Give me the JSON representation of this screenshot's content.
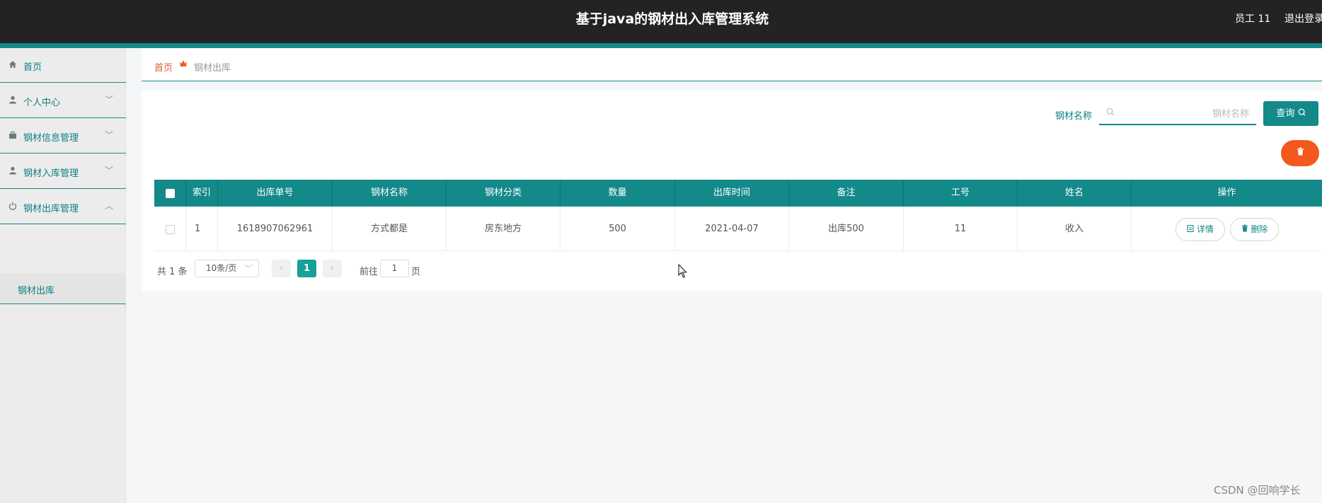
{
  "header": {
    "title": "基于java的钢材出入库管理系统",
    "user": "员工 11",
    "logout": "退出登录"
  },
  "sidebar": {
    "items": [
      {
        "label": "首页",
        "icon": "home-icon"
      },
      {
        "label": "个人中心",
        "icon": "person-icon"
      },
      {
        "label": "钢材信息管理",
        "icon": "briefcase-icon"
      },
      {
        "label": "钢材入库管理",
        "icon": "person-icon"
      },
      {
        "label": "钢材出库管理",
        "icon": "power-icon"
      }
    ],
    "sub_item": "钢材出库"
  },
  "breadcrumb": {
    "home": "首页",
    "current": "钢材出库"
  },
  "search": {
    "label": "钢材名称",
    "placeholder": "钢材名称",
    "button": "查询"
  },
  "table": {
    "headers": [
      "索引",
      "出库单号",
      "钢材名称",
      "钢材分类",
      "数量",
      "出库时间",
      "备注",
      "工号",
      "姓名",
      "操作"
    ],
    "rows": [
      {
        "index": "1",
        "order_no": "1618907062961",
        "name": "方式都是",
        "category": "房东地方",
        "quantity": "500",
        "time": "2021-04-07",
        "remark": "出库500",
        "emp_no": "11",
        "emp_name": "收入",
        "detail": "详情",
        "delete": "删除"
      }
    ]
  },
  "pagination": {
    "total": "共 1 条",
    "page_size": "10条/页",
    "current": "1",
    "goto": "前往",
    "goto_value": "1",
    "unit": "页"
  },
  "colors": {
    "primary": "#13898a",
    "accent": "#f3581c",
    "header_bg": "#232323"
  },
  "watermark": "CSDN @回响学长"
}
